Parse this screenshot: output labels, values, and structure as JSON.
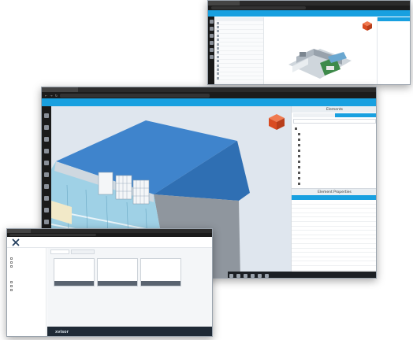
{
  "colors": {
    "accent": "#18a0e0",
    "dark_chrome": "#1c1c1c",
    "sky": "#dfe6ee",
    "roof": "#3f84cc",
    "cube": "#e2572b"
  },
  "window_back": {
    "title": "",
    "app_label": "",
    "grid_header": "",
    "list_items": [
      "",
      "",
      "",
      "",
      "",
      "",
      "",
      "",
      "",
      "",
      "",
      "",
      "",
      ""
    ]
  },
  "window_main": {
    "browser_tab": "",
    "address": "",
    "app_label": "",
    "menu_items": [
      "",
      "",
      ""
    ],
    "right_panel_title": "Elements",
    "tree_items": [
      "",
      "",
      "",
      "",
      "",
      "",
      "",
      "",
      "",
      "",
      "",
      "",
      "",
      "",
      "",
      ""
    ],
    "props_title": "Element Properties",
    "props_subtitle": "",
    "props_rows": [
      "",
      "",
      "",
      "",
      "",
      "",
      "",
      "",
      "",
      "",
      "",
      "",
      "",
      "",
      "",
      "",
      "",
      "",
      ""
    ]
  },
  "window_front": {
    "title": "",
    "logo_text": "",
    "tabs": [
      "",
      ""
    ],
    "sidebar_groups": [
      {
        "label": "",
        "items": [
          "",
          "",
          ""
        ]
      },
      {
        "label": "",
        "items": [
          "",
          "",
          ""
        ]
      }
    ],
    "cards": [
      {
        "title": "",
        "lines": [
          "",
          "",
          ""
        ],
        "actions": [
          "",
          ""
        ]
      },
      {
        "title": "",
        "lines": [
          "",
          "",
          ""
        ],
        "actions": [
          "",
          ""
        ]
      },
      {
        "title": "",
        "lines": [
          "",
          "",
          ""
        ],
        "actions": [
          "",
          ""
        ]
      }
    ],
    "footer_brand": "xvisor"
  }
}
